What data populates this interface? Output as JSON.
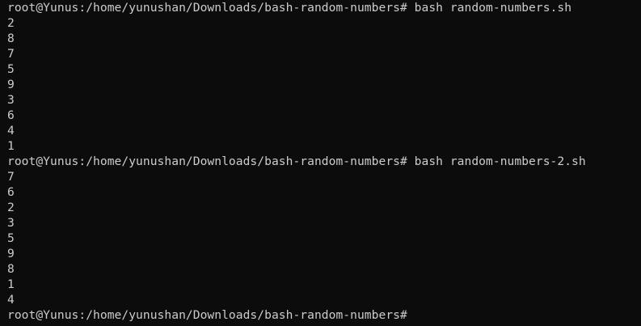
{
  "terminal": {
    "lines": [
      "root@Yunus:/home/yunushan/Downloads/bash-random-numbers# bash random-numbers.sh",
      "2",
      "8",
      "7",
      "5",
      "9",
      "3",
      "6",
      "4",
      "1",
      "root@Yunus:/home/yunushan/Downloads/bash-random-numbers# bash random-numbers-2.sh",
      "7",
      "6",
      "2",
      "3",
      "5",
      "9",
      "8",
      "1",
      "4",
      "root@Yunus:/home/yunushan/Downloads/bash-random-numbers#"
    ]
  },
  "colors": {
    "background": "#0c0c0c",
    "foreground": "#cccccc"
  }
}
